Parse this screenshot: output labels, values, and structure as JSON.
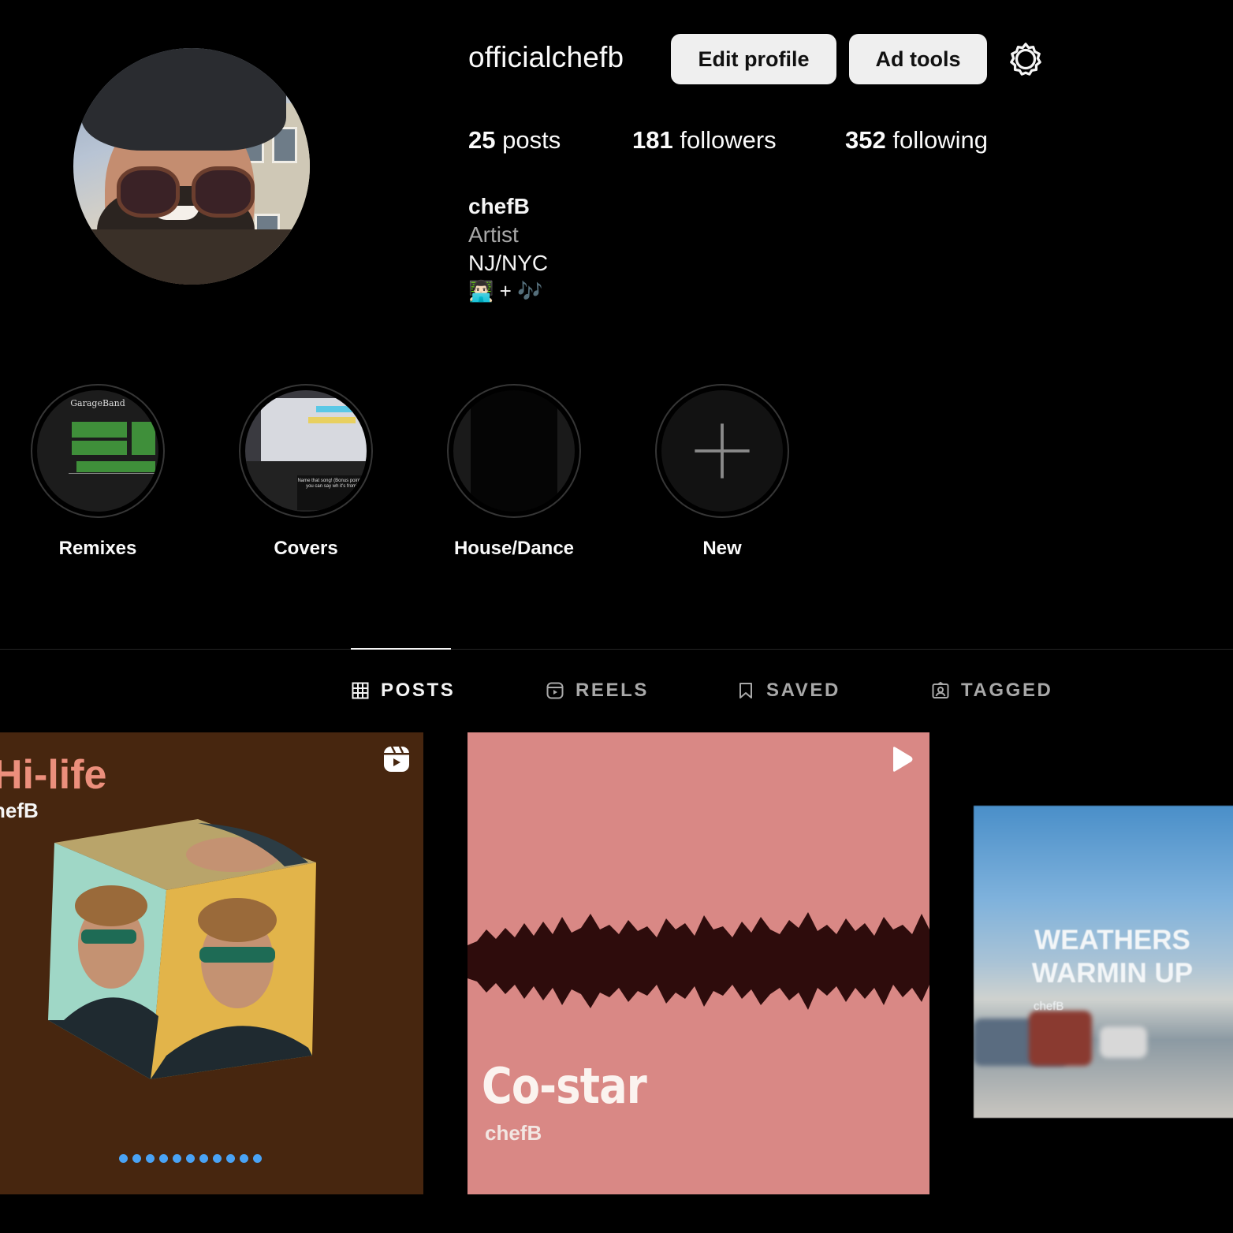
{
  "profile": {
    "username": "officialchefb",
    "edit_label": "Edit profile",
    "ad_tools_label": "Ad tools",
    "stats": {
      "posts_count": "25",
      "posts_label": " posts",
      "followers_count": "181",
      "followers_label": " followers",
      "following_count": "352",
      "following_label": " following"
    },
    "bio": {
      "name": "chefB",
      "category": "Artist",
      "location": "NJ/NYC",
      "emoji_line": "👨🏻‍💻 + 🎶"
    }
  },
  "highlights": [
    {
      "label": "Remixes",
      "cover_text": "GarageBand"
    },
    {
      "label": "Covers",
      "cover_text": "Name that song! (Bonus points if you can say wh it's from)"
    },
    {
      "label": "House/Dance"
    },
    {
      "label": "New"
    }
  ],
  "tabs": [
    {
      "label": "POSTS",
      "icon": "grid-icon",
      "active": true
    },
    {
      "label": "REELS",
      "icon": "reels-icon",
      "active": false
    },
    {
      "label": "SAVED",
      "icon": "bookmark-icon",
      "active": false
    },
    {
      "label": "TAGGED",
      "icon": "tagged-icon",
      "active": false
    }
  ],
  "posts": [
    {
      "title": "Hi-life",
      "artist": "hefB",
      "badge": "reel-icon",
      "bg": "#47260f"
    },
    {
      "title": "Co-star",
      "artist": "chefB",
      "badge": "play-icon",
      "bg": "#d98885"
    },
    {
      "title": "WEATHERS WARMIN UP",
      "artist": "chefB"
    }
  ],
  "colors": {
    "background": "#000000",
    "button_bg": "#efefef",
    "accent_blue": "#4aa3f5"
  }
}
